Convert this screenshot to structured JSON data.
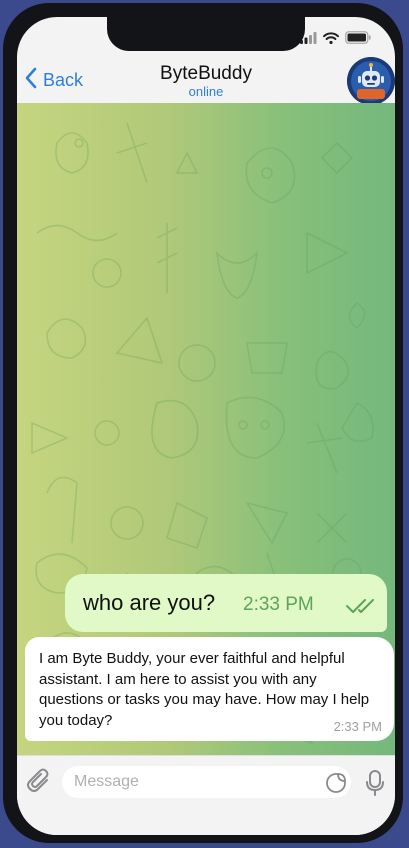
{
  "header": {
    "back_label": "Back",
    "title": "ByteBuddy",
    "status": "online"
  },
  "messages": [
    {
      "direction": "outgoing",
      "text": "who are you?",
      "time": "2:33 PM",
      "read": true
    },
    {
      "direction": "incoming",
      "text": "I am Byte Buddy, your ever faithful and helpful assistant. I am here to assist you with any questions or tasks you may have. How may I help you today?",
      "time": "2:33 PM"
    }
  ],
  "composer": {
    "placeholder": "Message"
  },
  "icons": {
    "back": "chevron-left-icon",
    "attach": "paperclip-icon",
    "sticker": "sticker-icon",
    "mic": "microphone-icon",
    "read_receipt": "double-check-icon",
    "signal": "signal-icon",
    "wifi": "wifi-icon",
    "battery": "battery-icon"
  },
  "colors": {
    "accent": "#2f7fd7",
    "outgoing_bubble": "#e0f9c6",
    "outgoing_time": "#5da45a",
    "incoming_bubble": "#ffffff",
    "chat_gradient_left": "#c6d57e",
    "chat_gradient_right": "#74b87d",
    "page_background": "#3b4a8c",
    "phone_frame": "#121418"
  }
}
